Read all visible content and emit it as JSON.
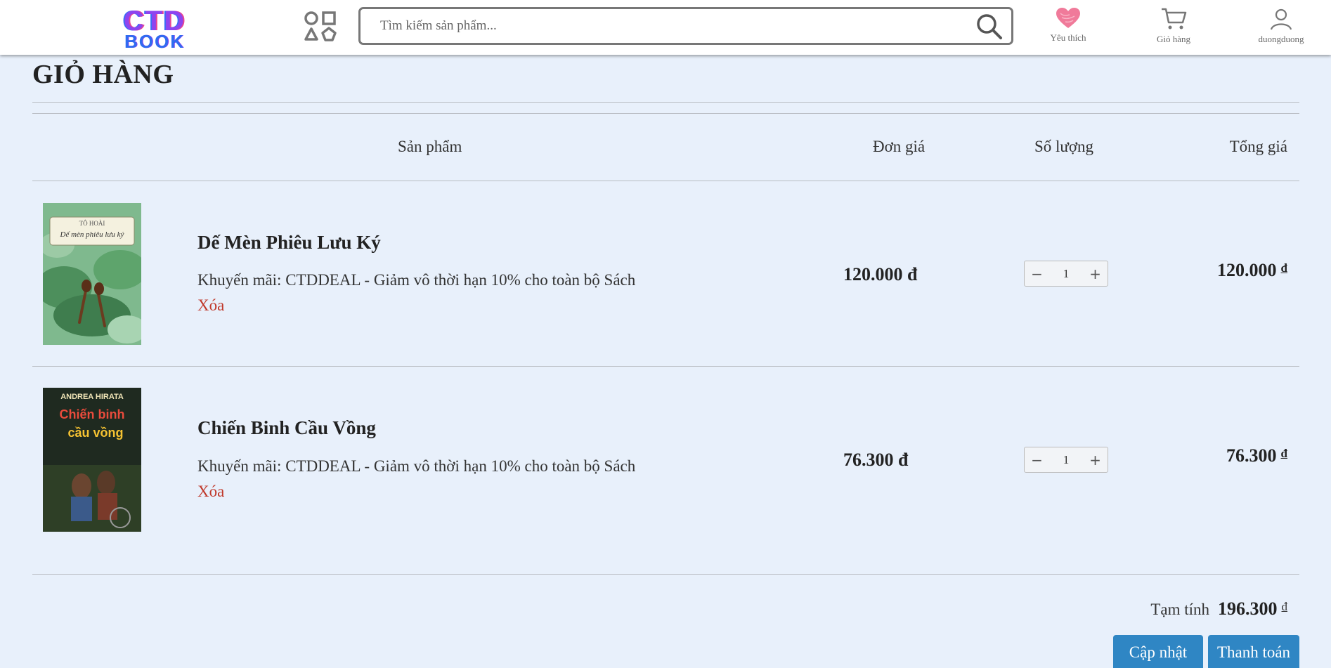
{
  "header": {
    "logo_line1": "CTD",
    "logo_line2": "BOOK",
    "search_placeholder": "Tìm kiếm sản phẩm...",
    "nav": {
      "wishlist_label": "Yêu thích",
      "cart_label": "Giỏ hàng",
      "user_label": "duongduong"
    }
  },
  "page": {
    "title": "GIỎ HÀNG"
  },
  "table": {
    "headers": {
      "product": "Sản phẩm",
      "unit_price": "Đơn giá",
      "quantity": "Số lượng",
      "total": "Tổng giá"
    },
    "items": [
      {
        "name": "Dế Mèn Phiêu Lưu Ký",
        "promo": "Khuyến mãi: CTDDEAL - Giảm vô thời hạn 10% cho toàn bộ Sách",
        "remove_label": "Xóa",
        "unit_price": "120.000 đ",
        "quantity": "1",
        "total": "120.000",
        "currency": "đ",
        "cover": {
          "author": "TÔ HOÀI",
          "title": "Dế mèn phiêu lưu ký"
        }
      },
      {
        "name": "Chiến Binh Cầu Vồng",
        "promo": "Khuyến mãi: CTDDEAL - Giảm vô thời hạn 10% cho toàn bộ Sách",
        "remove_label": "Xóa",
        "unit_price": "76.300 đ",
        "quantity": "1",
        "total": "76.300",
        "currency": "đ",
        "cover": {
          "author": "ANDREA HIRATA",
          "title_line1": "Chiến binh",
          "title_line2": "cầu vồng"
        }
      }
    ]
  },
  "summary": {
    "subtotal_label": "Tạm tính",
    "subtotal_value": "196.300",
    "currency": "đ",
    "update_button": "Cập nhật",
    "checkout_button": "Thanh toán"
  },
  "colors": {
    "background": "#e8f0fb",
    "accent_button": "#2f86c4",
    "remove_link": "#c0392b",
    "wishlist_heart": "#f07a9a"
  }
}
